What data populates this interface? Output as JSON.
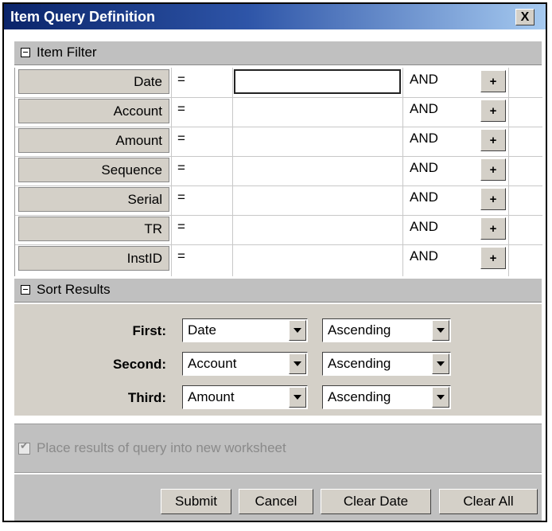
{
  "window": {
    "title": "Item Query Definition",
    "close_label": "X"
  },
  "filter": {
    "header": "Item Filter",
    "rows": [
      {
        "field": "Date",
        "operator": "=",
        "value": "",
        "conjunction": "AND",
        "add": "+"
      },
      {
        "field": "Account",
        "operator": "=",
        "value": "",
        "conjunction": "AND",
        "add": "+"
      },
      {
        "field": "Amount",
        "operator": "=",
        "value": "",
        "conjunction": "AND",
        "add": "+"
      },
      {
        "field": "Sequence",
        "operator": "=",
        "value": "",
        "conjunction": "AND",
        "add": "+"
      },
      {
        "field": "Serial",
        "operator": "=",
        "value": "",
        "conjunction": "AND",
        "add": "+"
      },
      {
        "field": "TR",
        "operator": "=",
        "value": "",
        "conjunction": "AND",
        "add": "+"
      },
      {
        "field": "InstID",
        "operator": "=",
        "value": "",
        "conjunction": "AND",
        "add": "+"
      }
    ]
  },
  "sort": {
    "header": "Sort Results",
    "rows": [
      {
        "label": "First:",
        "field": "Date",
        "order": "Ascending"
      },
      {
        "label": "Second:",
        "field": "Account",
        "order": "Ascending"
      },
      {
        "label": "Third:",
        "field": "Amount",
        "order": "Ascending"
      }
    ]
  },
  "option": {
    "label": "Place results of query into new worksheet",
    "checked": true,
    "enabled": false
  },
  "buttons": {
    "submit": "Submit",
    "cancel": "Cancel",
    "clear_date": "Clear Date",
    "clear_all": "Clear All"
  }
}
